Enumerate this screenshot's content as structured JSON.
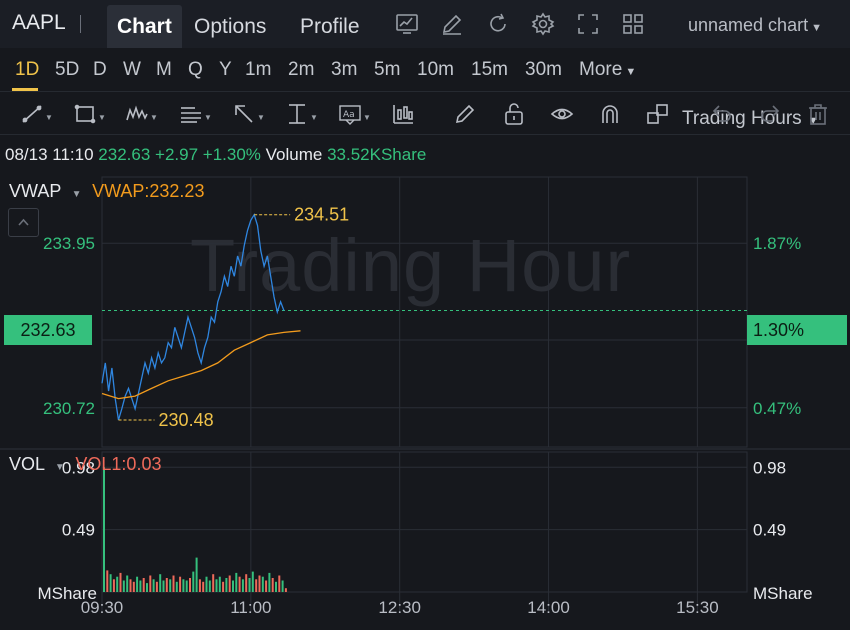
{
  "header": {
    "ticker": "AAPL",
    "tabs": [
      "Chart",
      "Options",
      "Profile"
    ],
    "active_tab": 0,
    "chart_name": "unnamed chart"
  },
  "periods": {
    "items": [
      "1D",
      "5D",
      "D",
      "W",
      "M",
      "Q",
      "Y",
      "1m",
      "2m",
      "3m",
      "5m",
      "10m",
      "15m",
      "30m",
      "More"
    ],
    "active": "1D",
    "session": "Trading Hours"
  },
  "info": {
    "datetime": "08/13 11:10",
    "price": "232.63",
    "change": "+2.97",
    "change_pct": "+1.30%",
    "volume_label": "Volume",
    "volume_value": "33.52KShare"
  },
  "indicators": {
    "main_name": "VWAP",
    "main_value": "VWAP:232.23",
    "sub_name": "VOL",
    "sub_value": "VOL1:0.03"
  },
  "watermark": "Trading Hour",
  "colors": {
    "up": "#35c07d",
    "down": "#ef6a5a",
    "price_line": "#2f86e0",
    "vwap_line": "#f29b1d",
    "marker": "#f0c34a",
    "grid": "#2a2e36"
  },
  "chart_data": [
    {
      "type": "line",
      "x_ticks": [
        "09:30",
        "11:00",
        "12:30",
        "14:00",
        "15:30"
      ],
      "xlim_minutes": [
        0,
        390
      ],
      "ylim": [
        229.95,
        235.25
      ],
      "left_ticks": [
        "233.95",
        "232.63",
        "230.72"
      ],
      "right_ticks": [
        "1.87%",
        "1.30%",
        "0.47%"
      ],
      "current_price": "232.63",
      "current_pct": "1.30%",
      "high_label": "234.51",
      "low_label": "230.48",
      "high": {
        "minute": 92,
        "value": 234.51
      },
      "low": {
        "minute": 10,
        "value": 230.48
      },
      "series": [
        {
          "points": [
            [
              0,
              231.2
            ],
            [
              2,
              231.6
            ],
            [
              4,
              231.05
            ],
            [
              6,
              231.5
            ],
            [
              8,
              230.9
            ],
            [
              10,
              230.48
            ],
            [
              12,
              230.7
            ],
            [
              14,
              230.95
            ],
            [
              16,
              231.1
            ],
            [
              18,
              230.9
            ],
            [
              20,
              230.7
            ],
            [
              22,
              231.0
            ],
            [
              24,
              231.3
            ],
            [
              26,
              231.6
            ],
            [
              28,
              231.4
            ],
            [
              30,
              231.7
            ],
            [
              32,
              231.5
            ],
            [
              34,
              231.8
            ],
            [
              36,
              231.6
            ],
            [
              38,
              231.7
            ],
            [
              40,
              232.0
            ],
            [
              42,
              231.9
            ],
            [
              44,
              232.3
            ],
            [
              46,
              232.1
            ],
            [
              48,
              231.9
            ],
            [
              50,
              232.2
            ],
            [
              52,
              232.5
            ],
            [
              54,
              232.3
            ],
            [
              56,
              232.1
            ],
            [
              58,
              231.8
            ],
            [
              60,
              231.6
            ],
            [
              62,
              231.9
            ],
            [
              64,
              232.1
            ],
            [
              66,
              232.5
            ],
            [
              68,
              232.4
            ],
            [
              70,
              232.8
            ],
            [
              72,
              233.0
            ],
            [
              74,
              233.3
            ],
            [
              76,
              233.1
            ],
            [
              78,
              233.5
            ],
            [
              80,
              233.3
            ],
            [
              82,
              233.7
            ],
            [
              84,
              233.5
            ],
            [
              86,
              233.9
            ],
            [
              88,
              234.2
            ],
            [
              90,
              234.4
            ],
            [
              92,
              234.51
            ],
            [
              94,
              234.3
            ],
            [
              96,
              233.8
            ],
            [
              98,
              233.5
            ],
            [
              100,
              233.7
            ],
            [
              102,
              233.3
            ],
            [
              104,
              232.9
            ],
            [
              106,
              232.6
            ],
            [
              108,
              232.8
            ],
            [
              110,
              232.63
            ]
          ]
        },
        {
          "points": [
            [
              0,
              231.0
            ],
            [
              10,
              230.9
            ],
            [
              20,
              230.95
            ],
            [
              30,
              231.1
            ],
            [
              40,
              231.25
            ],
            [
              50,
              231.35
            ],
            [
              60,
              231.45
            ],
            [
              70,
              231.6
            ],
            [
              80,
              231.85
            ],
            [
              90,
              232.0
            ],
            [
              100,
              232.15
            ],
            [
              110,
              232.2
            ],
            [
              120,
              232.23
            ]
          ]
        }
      ]
    },
    {
      "type": "bar",
      "left_ticks": [
        "0.98",
        "0.49",
        "MShare"
      ],
      "right_ticks": [
        "0.98",
        "0.49",
        "MShare"
      ],
      "ylim": [
        0,
        1.1
      ],
      "bar_minutes": [
        0,
        2,
        4,
        6,
        8,
        10,
        12,
        14,
        16,
        18,
        20,
        22,
        24,
        26,
        28,
        30,
        32,
        34,
        36,
        38,
        40,
        42,
        44,
        46,
        48,
        50,
        52,
        54,
        56,
        58,
        60,
        62,
        64,
        66,
        68,
        70,
        72,
        74,
        76,
        78,
        80,
        82,
        84,
        86,
        88,
        90,
        92,
        94,
        96,
        98,
        100,
        102,
        104,
        106,
        108,
        110
      ],
      "values": [
        0.98,
        0.17,
        0.14,
        0.1,
        0.12,
        0.15,
        0.09,
        0.13,
        0.1,
        0.08,
        0.12,
        0.09,
        0.11,
        0.07,
        0.13,
        0.1,
        0.08,
        0.14,
        0.09,
        0.11,
        0.1,
        0.13,
        0.08,
        0.12,
        0.1,
        0.09,
        0.11,
        0.16,
        0.27,
        0.1,
        0.08,
        0.12,
        0.09,
        0.14,
        0.1,
        0.12,
        0.08,
        0.11,
        0.13,
        0.09,
        0.15,
        0.12,
        0.1,
        0.14,
        0.11,
        0.16,
        0.1,
        0.13,
        0.12,
        0.09,
        0.15,
        0.11,
        0.08,
        0.13,
        0.09,
        0.03
      ],
      "up": [
        1,
        0,
        1,
        0,
        1,
        0,
        1,
        1,
        0,
        0,
        1,
        1,
        0,
        1,
        0,
        1,
        0,
        1,
        1,
        0,
        1,
        0,
        1,
        0,
        1,
        1,
        0,
        1,
        1,
        0,
        0,
        1,
        1,
        0,
        1,
        1,
        0,
        1,
        0,
        1,
        1,
        0,
        1,
        0,
        1,
        1,
        0,
        0,
        1,
        0,
        1,
        0,
        1,
        0,
        1,
        0
      ]
    }
  ]
}
